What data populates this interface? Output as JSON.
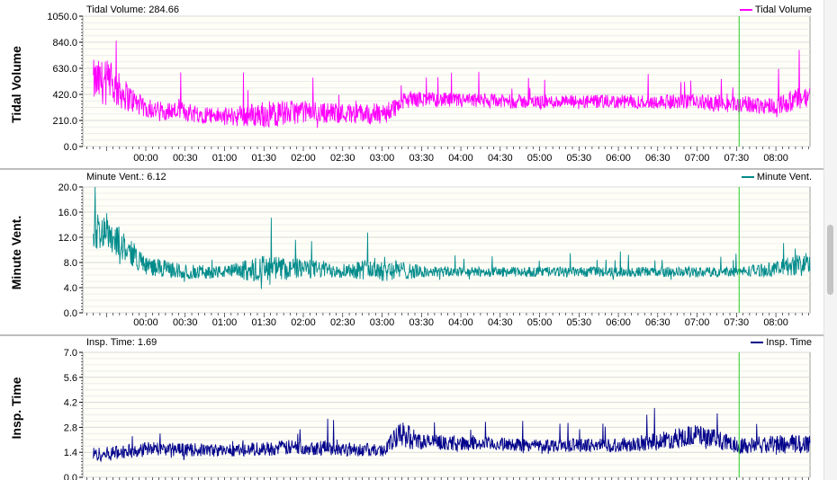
{
  "chart_data": [
    {
      "type": "line",
      "ylabel": "Tidal Volume",
      "readout": "Tidal Volume: 284.66",
      "legend": "Tidal Volume",
      "color": "#ff00ff",
      "ylim": [
        0,
        1050
      ],
      "yticks": [
        "0.0",
        "210.0",
        "420.0",
        "630.0",
        "840.0",
        "1050.0"
      ],
      "ytick_values": [
        0,
        210,
        420,
        630,
        840,
        1050
      ],
      "xticks": [
        "00:00",
        "00:30",
        "01:00",
        "01:30",
        "02:00",
        "02:30",
        "03:00",
        "03:30",
        "04:00",
        "04:30",
        "05:00",
        "05:30",
        "06:00",
        "06:30",
        "07:00",
        "07:30",
        "08:00"
      ],
      "grid": true,
      "legend_position": "top-right",
      "series_profile": {
        "x": [
          "23:30",
          "00:00",
          "00:30",
          "01:00",
          "01:30",
          "02:00",
          "02:30",
          "03:00",
          "03:20",
          "03:30",
          "04:00",
          "05:00",
          "06:00",
          "07:00",
          "07:30",
          "08:00",
          "08:25"
        ],
        "baseline": [
          520,
          300,
          280,
          240,
          260,
          280,
          270,
          260,
          380,
          380,
          370,
          360,
          360,
          360,
          340,
          330,
          400
        ],
        "noise": [
          180,
          70,
          80,
          70,
          110,
          90,
          80,
          90,
          70,
          60,
          60,
          55,
          55,
          60,
          70,
          70,
          110
        ]
      }
    },
    {
      "type": "line",
      "ylabel": "Minute Vent.",
      "readout": "Minute Vent.: 6.12",
      "legend": "Minute Vent.",
      "color": "#008b8b",
      "ylim": [
        0,
        20
      ],
      "yticks": [
        "0.0",
        "4.0",
        "8.0",
        "12.0",
        "16.0",
        "20.0"
      ],
      "ytick_values": [
        0,
        4,
        8,
        12,
        16,
        20
      ],
      "xticks": [
        "00:00",
        "00:30",
        "01:00",
        "01:30",
        "02:00",
        "02:30",
        "03:00",
        "03:30",
        "04:00",
        "04:30",
        "05:00",
        "05:30",
        "06:00",
        "06:30",
        "07:00",
        "07:30",
        "08:00"
      ],
      "grid": true,
      "legend_position": "top-right",
      "series_profile": {
        "x": [
          "23:30",
          "00:00",
          "00:30",
          "01:00",
          "01:30",
          "02:00",
          "02:30",
          "03:00",
          "03:30",
          "04:00",
          "05:00",
          "06:00",
          "07:00",
          "07:30",
          "08:00",
          "08:25"
        ],
        "baseline": [
          13,
          7.5,
          6.5,
          6.5,
          7,
          7,
          6.8,
          7,
          6.5,
          6.5,
          6.5,
          6.5,
          6.5,
          6.5,
          7,
          8
        ],
        "noise": [
          3,
          1.5,
          1.2,
          1.0,
          2.2,
          1.6,
          1.2,
          2.0,
          1.0,
          0.8,
          0.8,
          0.8,
          0.8,
          0.8,
          1.2,
          2.0
        ]
      }
    },
    {
      "type": "line",
      "ylabel": "Insp. Time",
      "readout": "Insp. Time: 1.69",
      "legend": "Insp. Time",
      "color": "#00008b",
      "ylim": [
        0,
        7
      ],
      "yticks": [
        "0.0",
        "1.4",
        "2.8",
        "4.2",
        "5.6",
        "7.0"
      ],
      "ytick_values": [
        0,
        1.4,
        2.8,
        4.2,
        5.6,
        7.0
      ],
      "grid": true,
      "legend_position": "top-right",
      "series_profile": {
        "x": [
          "23:30",
          "00:00",
          "01:00",
          "02:00",
          "03:00",
          "03:15",
          "03:30",
          "04:00",
          "05:00",
          "06:00",
          "06:30",
          "07:00",
          "07:30",
          "08:00",
          "08:25"
        ],
        "baseline": [
          1.3,
          1.6,
          1.5,
          1.7,
          1.5,
          2.4,
          2.0,
          1.9,
          1.8,
          1.8,
          2.0,
          2.4,
          1.8,
          1.8,
          1.9
        ],
        "noise": [
          0.4,
          0.4,
          0.35,
          0.45,
          0.35,
          0.8,
          0.45,
          0.4,
          0.35,
          0.4,
          0.5,
          0.6,
          0.45,
          0.55,
          0.6
        ]
      }
    }
  ],
  "cursor_time": "07:32",
  "cursor_color": "#22cc22",
  "plot_background": "#fffff8"
}
